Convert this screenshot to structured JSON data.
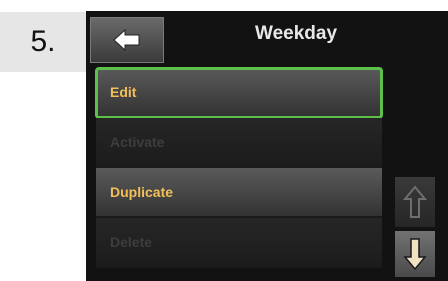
{
  "step": {
    "label": "5."
  },
  "header": {
    "title": "Weekday",
    "back_icon": "arrow-left-icon"
  },
  "menu": {
    "items": [
      {
        "label": "Edit",
        "state": "selected"
      },
      {
        "label": "Activate",
        "state": "disabled"
      },
      {
        "label": "Duplicate",
        "state": "active"
      },
      {
        "label": "Delete",
        "state": "disabled"
      }
    ]
  },
  "scroll": {
    "up_icon": "arrow-up-icon",
    "down_icon": "arrow-down-icon"
  },
  "colors": {
    "accent_text": "#f2bf5a",
    "selection_outline": "#5cc04a",
    "background": "#121212"
  }
}
